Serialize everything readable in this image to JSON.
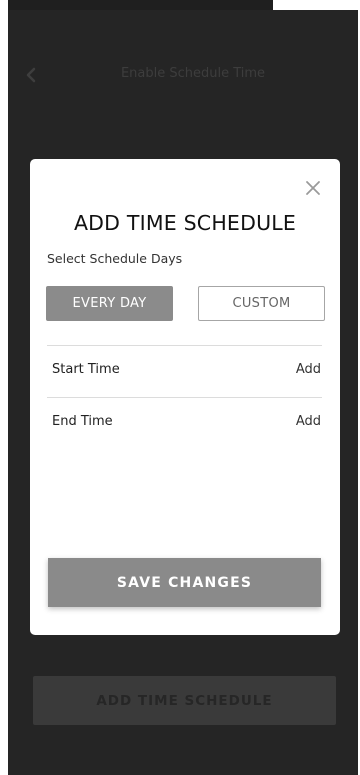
{
  "colors": {
    "backdrop": "#252525",
    "modal_bg": "#ffffff",
    "primary_button": "#8a8a8a",
    "text_dark": "#111111"
  },
  "nav": {
    "back_icon": "chevron-left-icon",
    "title": "Enable Schedule Time"
  },
  "page_button": {
    "label": "ADD TIME SCHEDULE"
  },
  "modal": {
    "close_icon": "close-icon",
    "title": "ADD TIME SCHEDULE",
    "days_label": "Select Schedule Days",
    "day_options": [
      {
        "label": "EVERY DAY",
        "selected": true
      },
      {
        "label": "CUSTOM",
        "selected": false
      }
    ],
    "rows": [
      {
        "label": "Start Time",
        "action": "Add"
      },
      {
        "label": "End Time",
        "action": "Add"
      }
    ],
    "save_label": "SAVE CHANGES"
  }
}
